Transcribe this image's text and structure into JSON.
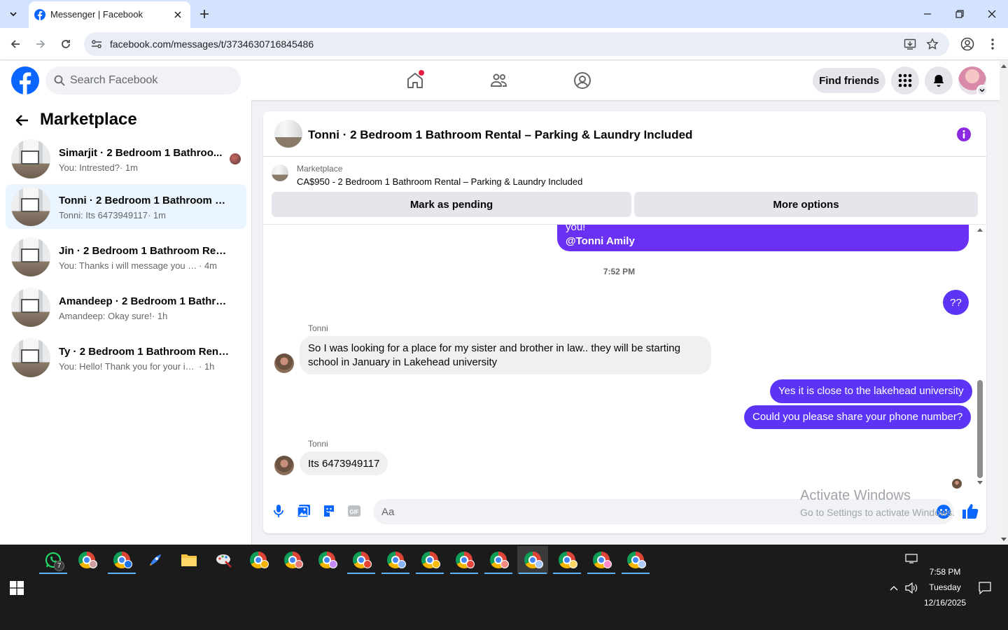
{
  "browser": {
    "tab_title": "Messenger | Facebook",
    "url": "facebook.com/messages/t/3734630716845486"
  },
  "header": {
    "search_placeholder": "Search Facebook",
    "find_friends": "Find friends"
  },
  "sidebar": {
    "title": "Marketplace",
    "conversations": [
      {
        "name": "Simarjit · 2 Bedroom 1 Bathroo...",
        "preview": "You: Intrested?",
        "time": "· 1m",
        "active": false
      },
      {
        "name": "Tonni · 2 Bedroom 1 Bathroom Re...",
        "preview": "Tonni: Its 6473949117",
        "time": "· 1m",
        "active": true
      },
      {
        "name": "Jin · 2 Bedroom 1 Bathroom Rental...",
        "preview": "You: Thanks i will message you in a ...",
        "time": "· 4m",
        "active": false
      },
      {
        "name": "Amandeep · 2 Bedroom 1 Bathroo...",
        "preview": "Amandeep: Okay sure!",
        "time": "· 1h",
        "active": false
      },
      {
        "name": "Ty · 2 Bedroom 1 Bathroom Rental ...",
        "preview": "You: Hello! Thank you for your interes...",
        "time": "· 1h",
        "active": false
      }
    ]
  },
  "chat": {
    "title": "Tonni · 2 Bedroom 1 Bathroom Rental – Parking & Laundry Included",
    "listing_label": "Marketplace",
    "listing_price": "CA$950 - 2 Bedroom 1 Bathroom Rental – Parking & Laundry Included",
    "btn_pending": "Mark as pending",
    "btn_more": "More options",
    "messages": {
      "top_cut_line1": "you!",
      "top_cut_line2": "@Tonni Amily",
      "timestamp": "7:52 PM",
      "me_q": "??",
      "sender1": "Tonni",
      "them1": "So I was looking for a place for my sister and brother in law.. they will be starting school in January in Lakehead university",
      "me1": "Yes it is close to the lakehead university",
      "me2": "Could you please share your phone number?",
      "sender2": "Tonni",
      "them2": "Its 6473949117"
    },
    "composer_placeholder": "Aa"
  },
  "watermark": {
    "line1": "Activate Windows",
    "line2": "Go to Settings to activate Windows."
  },
  "taskbar": {
    "whatsapp_badge": "7",
    "time": "7:58 PM",
    "day": "Tuesday",
    "date": "12/16/2025"
  },
  "colors": {
    "fb_blue": "#0866ff",
    "messenger_purple": "#5b34f5",
    "active_conv_bg": "#ebf5ff"
  }
}
